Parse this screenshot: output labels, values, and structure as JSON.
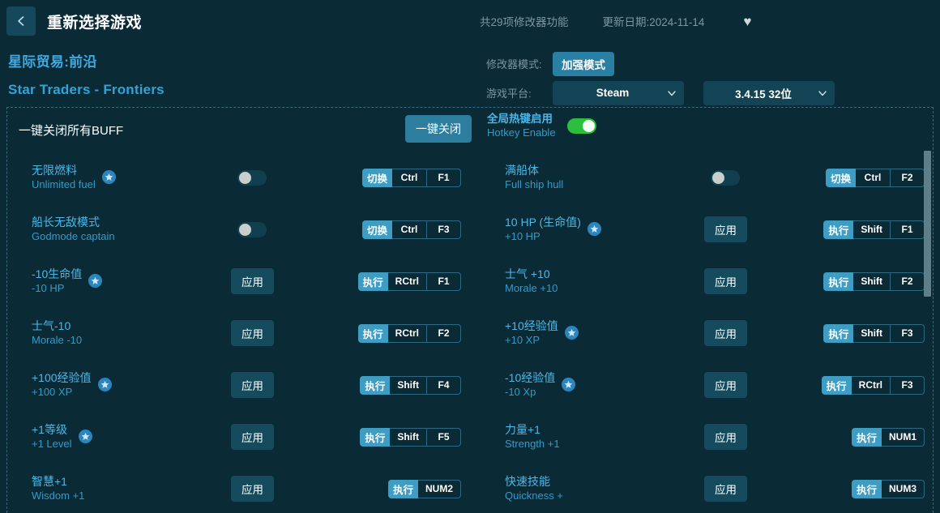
{
  "header": {
    "back_icon": "chevron-left-icon",
    "title": "重新选择游戏",
    "feature_count": "共29项修改器功能",
    "update_date": "更新日期:2024-11-14",
    "favorite_icon": "♥"
  },
  "game": {
    "name_cn": "星际贸易:前沿",
    "name_en": "Star Traders - Frontiers"
  },
  "options": {
    "mode_label": "修改器模式:",
    "mode_value": "加强模式",
    "platform_label": "游戏平台:",
    "platform_value": "Steam",
    "version_value": "3.4.15 32位"
  },
  "buff_bar": {
    "label": "一键关闭所有BUFF",
    "close_all_label": "一键关闭",
    "hotkey_cn": "全局热键启用",
    "hotkey_en": "Hotkey Enable",
    "hotkey_state": "on"
  },
  "colors": {
    "background": "#0a2a36",
    "accent": "#3f9dc4",
    "toggle_on": "#2cbf3d",
    "label_cn": "#4cb8e6",
    "label_en": "#2f9ccb"
  },
  "cheats": {
    "left": [
      {
        "name_cn": "无限燃料",
        "name_en": "Unlimited fuel",
        "star": true,
        "control": "toggle",
        "toggle_state": "off",
        "hk_action": "切换",
        "hk_keys": [
          "Ctrl",
          "F1"
        ]
      },
      {
        "name_cn": "船长无敌模式",
        "name_en": "Godmode captain",
        "star": false,
        "control": "toggle",
        "toggle_state": "off",
        "hk_action": "切换",
        "hk_keys": [
          "Ctrl",
          "F3"
        ]
      },
      {
        "name_cn": "-10生命值",
        "name_en": "-10 HP",
        "star": true,
        "control": "button",
        "button_label": "应用",
        "hk_action": "执行",
        "hk_keys": [
          "RCtrl",
          "F1"
        ]
      },
      {
        "name_cn": "士气-10",
        "name_en": "Morale -10",
        "star": false,
        "control": "button",
        "button_label": "应用",
        "hk_action": "执行",
        "hk_keys": [
          "RCtrl",
          "F2"
        ]
      },
      {
        "name_cn": "+100经验值",
        "name_en": "+100 XP",
        "star": true,
        "control": "button",
        "button_label": "应用",
        "hk_action": "执行",
        "hk_keys": [
          "Shift",
          "F4"
        ]
      },
      {
        "name_cn": "+1等级",
        "name_en": "+1 Level",
        "star": true,
        "control": "button",
        "button_label": "应用",
        "hk_action": "执行",
        "hk_keys": [
          "Shift",
          "F5"
        ]
      },
      {
        "name_cn": "智慧+1",
        "name_en": "Wisdom +1",
        "star": false,
        "control": "button",
        "button_label": "应用",
        "hk_action": "执行",
        "hk_keys": [
          "NUM2"
        ]
      }
    ],
    "right": [
      {
        "name_cn": "满船体",
        "name_en": "Full ship hull",
        "star": false,
        "control": "toggle",
        "toggle_state": "off",
        "hk_action": "切换",
        "hk_keys": [
          "Ctrl",
          "F2"
        ]
      },
      {
        "name_cn": "10 HP (生命值)",
        "name_en": "+10 HP",
        "star": true,
        "control": "button",
        "button_label": "应用",
        "hk_action": "执行",
        "hk_keys": [
          "Shift",
          "F1"
        ]
      },
      {
        "name_cn": "士气 +10",
        "name_en": "Morale +10",
        "star": false,
        "control": "button",
        "button_label": "应用",
        "hk_action": "执行",
        "hk_keys": [
          "Shift",
          "F2"
        ]
      },
      {
        "name_cn": "+10经验值",
        "name_en": "+10 XP",
        "star": true,
        "control": "button",
        "button_label": "应用",
        "hk_action": "执行",
        "hk_keys": [
          "Shift",
          "F3"
        ]
      },
      {
        "name_cn": "-10经验值",
        "name_en": "-10 Xp",
        "star": true,
        "control": "button",
        "button_label": "应用",
        "hk_action": "执行",
        "hk_keys": [
          "RCtrl",
          "F3"
        ]
      },
      {
        "name_cn": "力量+1",
        "name_en": "Strength +1",
        "star": false,
        "control": "button",
        "button_label": "应用",
        "hk_action": "执行",
        "hk_keys": [
          "NUM1"
        ]
      },
      {
        "name_cn": "快速技能",
        "name_en": "Quickness +",
        "star": false,
        "control": "button",
        "button_label": "应用",
        "hk_action": "执行",
        "hk_keys": [
          "NUM3"
        ]
      }
    ]
  }
}
